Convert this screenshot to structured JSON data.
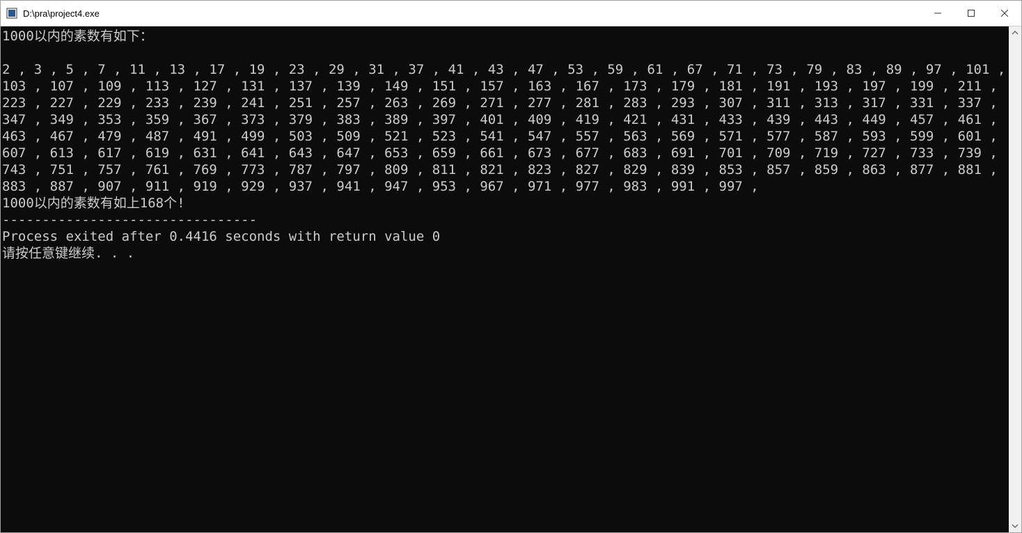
{
  "window": {
    "title": "D:\\pra\\project4.exe"
  },
  "console": {
    "header_line": "1000以内的素数有如下：",
    "primes_block": "2 , 3 , 5 , 7 , 11 , 13 , 17 , 19 , 23 , 29 , 31 , 37 , 41 , 43 , 47 , 53 , 59 , 61 , 67 , 71 , 73 , 79 , 83 , 89 , 97 , 101 , 103 , 107 , 109 , 113 , 127 , 131 , 137 , 139 , 149 , 151 , 157 , 163 , 167 , 173 , 179 , 181 , 191 , 193 , 197 , 199 , 211 , 223 , 227 , 229 , 233 , 239 , 241 , 251 , 257 , 263 , 269 , 271 , 277 , 281 , 283 , 293 , 307 , 311 , 313 , 317 , 331 , 337 , 347 , 349 , 353 , 359 , 367 , 373 , 379 , 383 , 389 , 397 , 401 , 409 , 419 , 421 , 431 , 433 , 439 , 443 , 449 , 457 , 461 , 463 , 467 , 479 , 487 , 491 , 499 , 503 , 509 , 521 , 523 , 541 , 547 , 557 , 563 , 569 , 571 , 577 , 587 , 593 , 599 , 601 , 607 , 613 , 617 , 619 , 631 , 641 , 643 , 647 , 653 , 659 , 661 , 673 , 677 , 683 , 691 , 701 , 709 , 719 , 727 , 733 , 739 , 743 , 751 , 757 , 761 , 769 , 773 , 787 , 797 , 809 , 811 , 821 , 823 , 827 , 829 , 839 , 853 , 857 , 859 , 863 , 877 , 881 , 883 , 887 , 907 , 911 , 919 , 929 , 937 , 941 , 947 , 953 , 967 , 971 , 977 , 983 , 991 , 997 , ",
    "summary_line": "1000以内的素数有如上168个!",
    "separator_line": "--------------------------------",
    "exit_line": "Process exited after 0.4416 seconds with return value 0",
    "prompt_line": "请按任意键继续. . ."
  }
}
